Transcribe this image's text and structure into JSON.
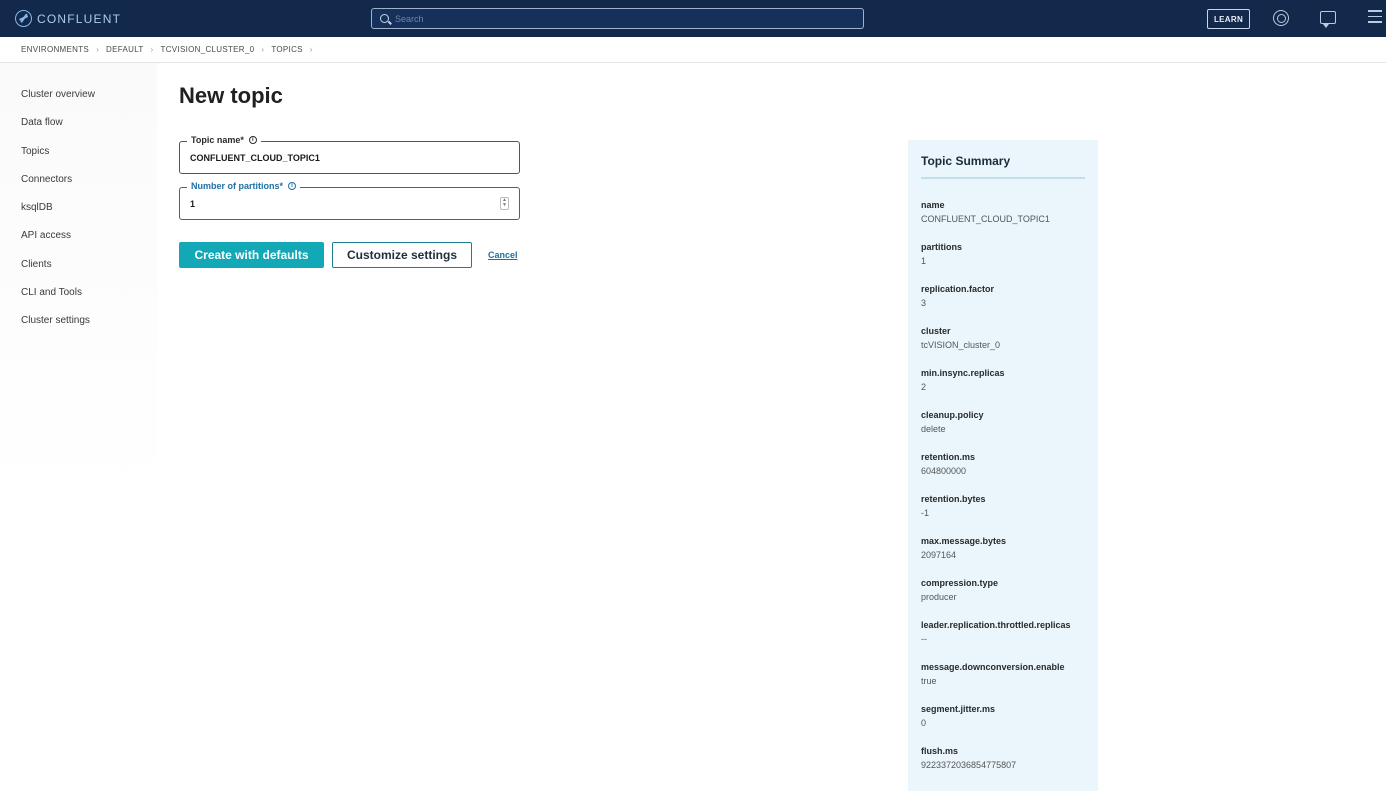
{
  "header": {
    "logo_text": "CONFLUENT",
    "search_placeholder": "Search",
    "learn_label": "LEARN"
  },
  "breadcrumb": [
    "ENVIRONMENTS",
    "DEFAULT",
    "TCVISION_CLUSTER_0",
    "TOPICS"
  ],
  "sidebar": {
    "items": [
      {
        "label": "Cluster overview"
      },
      {
        "label": "Data flow"
      },
      {
        "label": "Topics"
      },
      {
        "label": "Connectors"
      },
      {
        "label": "ksqlDB"
      },
      {
        "label": "API access"
      },
      {
        "label": "Clients"
      },
      {
        "label": "CLI and Tools"
      },
      {
        "label": "Cluster settings"
      }
    ]
  },
  "main": {
    "title": "New topic",
    "topic_name": {
      "label": "Topic name*",
      "value": "CONFLUENT_CLOUD_TOPIC1"
    },
    "partitions": {
      "label": "Number of partitions*",
      "value": "1"
    },
    "create_label": "Create with defaults",
    "customize_label": "Customize settings",
    "cancel_label": "Cancel"
  },
  "summary": {
    "title": "Topic Summary",
    "rows": [
      {
        "key": "name",
        "value": "CONFLUENT_CLOUD_TOPIC1"
      },
      {
        "key": "partitions",
        "value": "1"
      },
      {
        "key": "replication.factor",
        "value": "3"
      },
      {
        "key": "cluster",
        "value": "tcVISION_cluster_0"
      },
      {
        "key": "min.insync.replicas",
        "value": "2"
      },
      {
        "key": "cleanup.policy",
        "value": "delete"
      },
      {
        "key": "retention.ms",
        "value": "604800000"
      },
      {
        "key": "retention.bytes",
        "value": "-1"
      },
      {
        "key": "max.message.bytes",
        "value": "2097164"
      },
      {
        "key": "compression.type",
        "value": "producer"
      },
      {
        "key": "leader.replication.throttled.replicas",
        "value": "--"
      },
      {
        "key": "message.downconversion.enable",
        "value": "true"
      },
      {
        "key": "segment.jitter.ms",
        "value": "0"
      },
      {
        "key": "flush.ms",
        "value": "9223372036854775807"
      }
    ]
  }
}
